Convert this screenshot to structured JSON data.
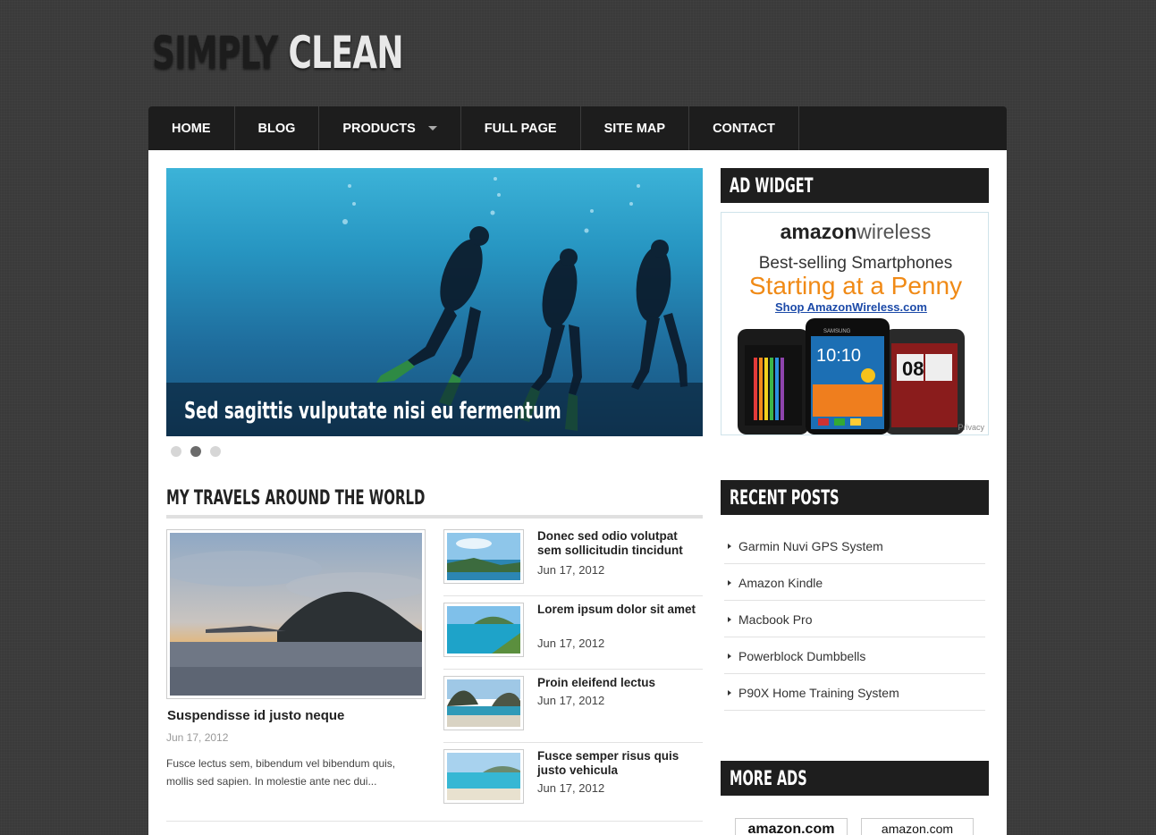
{
  "site": {
    "logo_word1": "SIMPLY",
    "logo_word2": "CLEAN"
  },
  "nav": {
    "items": [
      {
        "label": "HOME"
      },
      {
        "label": "BLOG"
      },
      {
        "label": "PRODUCTS",
        "has_dropdown": true
      },
      {
        "label": "FULL PAGE"
      },
      {
        "label": "SITE MAP"
      },
      {
        "label": "CONTACT"
      }
    ]
  },
  "slider": {
    "caption": "Sed sagittis vulputate nisi eu fermentum",
    "slides": 3,
    "active_slide": 2
  },
  "section": {
    "title": "MY TRAVELS AROUND THE WORLD"
  },
  "featured": {
    "title": "Suspendisse id justo neque",
    "date": "Jun 17, 2012",
    "excerpt": "Fusce lectus sem, bibendum vel bibendum quis, mollis sed sapien. In molestie ante nec dui..."
  },
  "posts": [
    {
      "title": "Donec sed odio volutpat sem sollicitudin tincidunt",
      "date": "Jun 17, 2012"
    },
    {
      "title": "Lorem ipsum dolor sit amet",
      "date": "Jun 17, 2012"
    },
    {
      "title": "Proin eleifend lectus",
      "date": "Jun 17, 2012"
    },
    {
      "title": "Fusce semper risus quis justo vehicula",
      "date": "Jun 17, 2012"
    }
  ],
  "sidebar": {
    "ad_widget_title": "AD WIDGET",
    "ad": {
      "logo_part1": "amazon",
      "logo_part2": "wireless",
      "line1": "Best-selling Smartphones",
      "line2": "Starting at a Penny",
      "link": "Shop AmazonWireless.com",
      "privacy": "Privacy",
      "phone_brand": "SAMSUNG",
      "phone_time": "10:10",
      "phone_time2": "08"
    },
    "recent_title": "RECENT POSTS",
    "recent_posts": [
      {
        "label": "Garmin Nuvi GPS System"
      },
      {
        "label": "Amazon Kindle"
      },
      {
        "label": "Macbook Pro"
      },
      {
        "label": "Powerblock Dumbbells"
      },
      {
        "label": "P90X Home Training System"
      }
    ],
    "more_ads_title": "MORE ADS",
    "more_ads": [
      {
        "label": "amazon.com"
      },
      {
        "label": "amazon.com"
      }
    ]
  }
}
